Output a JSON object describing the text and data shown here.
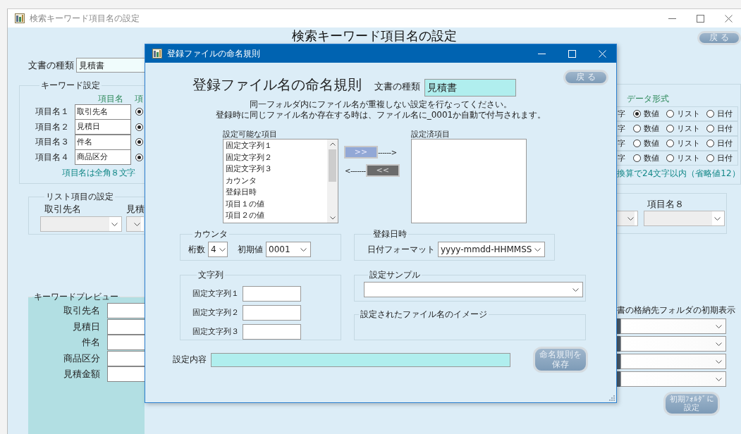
{
  "background_window": {
    "title": "検索キーワード項目名の設定",
    "heading": "検索キーワード項目名の設定",
    "back_button": {
      "label": "戻 る",
      "disabled": true
    },
    "doc_type": {
      "label": "文書の種類",
      "value": "見積書"
    },
    "keyword_settings": {
      "title": "キーワード設定",
      "column_1": "項目名",
      "column_2": "項",
      "note": "項目名は全角８文字",
      "rows": [
        {
          "label": "項目名１",
          "value": "取引先名",
          "option_selected": true
        },
        {
          "label": "項目名２",
          "value": "見積日",
          "option_selected": true
        },
        {
          "label": "項目名３",
          "value": "件名",
          "option_selected": true
        },
        {
          "label": "項目名４",
          "value": "商品区分",
          "option_selected": true
        }
      ]
    },
    "data_format": {
      "title": "データ形式",
      "note": "換算で24文字以内（省略値12）",
      "rows": [
        {
          "fragment": "字",
          "options": [
            {
              "label": "数値",
              "selected": true
            },
            {
              "label": "リスト",
              "selected": false
            },
            {
              "label": "日付",
              "selected": false
            }
          ]
        },
        {
          "fragment": "字",
          "options": [
            {
              "label": "数値",
              "selected": false
            },
            {
              "label": "リスト",
              "selected": false
            },
            {
              "label": "日付",
              "selected": false
            }
          ]
        },
        {
          "fragment": "字",
          "options": [
            {
              "label": "数値",
              "selected": false
            },
            {
              "label": "リスト",
              "selected": false
            },
            {
              "label": "日付",
              "selected": false
            }
          ]
        },
        {
          "fragment": "字",
          "options": [
            {
              "label": "数値",
              "selected": false
            },
            {
              "label": "リスト",
              "selected": false
            },
            {
              "label": "日付",
              "selected": false
            }
          ]
        }
      ]
    },
    "list_settings": {
      "title": "リスト項目の設定",
      "left_labels": [
        "取引先名",
        "見積"
      ],
      "right_labels": [
        "項目名８"
      ]
    },
    "keyword_preview": {
      "title": "キーワードプレビュー",
      "fields": [
        "取引先名",
        "見積日",
        "件名",
        "商品区分",
        "見積金額"
      ]
    },
    "folder_defaults": {
      "title": "書の格納先フォルダの初期表示"
    },
    "set_folder_button": {
      "label": "初期ﾌｫﾙﾀﾞに設定",
      "disabled": true
    }
  },
  "dialog": {
    "title": "登録ファイルの命名規則",
    "back_button": {
      "label": "戻 る",
      "disabled": true
    },
    "heading": "登録ファイル名の命名規則",
    "doc_type": {
      "label": "文書の種類",
      "value": "見積書"
    },
    "instructions": [
      "同一フォルダ内にファイル名が重複しない設定を行なってください。",
      "登録時に同じファイル名か存在する時は、ファイル名に_0001か自動で付与されます。"
    ],
    "available": {
      "title": "設定可能な項目",
      "items": [
        "固定文字列１",
        "固定文字列２",
        "固定文字列３",
        "カウンタ",
        "登録日時",
        "項目１の値",
        "項目２の値"
      ]
    },
    "add_button": ">>",
    "add_arrow": "------>",
    "remove_arrow": "<-------",
    "remove_button": "<<",
    "configured": {
      "title": "設定済項目"
    },
    "counter": {
      "title": "カウンタ",
      "digits_label": "桁数",
      "digits": "4",
      "initial_label": "初期値",
      "initial": "0001"
    },
    "registered_at": {
      "title": "登録日時",
      "format_label": "日付フォーマット",
      "format": "yyyy-mmdd-HHMMSS"
    },
    "strings": {
      "title": "文字列",
      "fields": [
        "固定文字列１",
        "固定文字列２",
        "固定文字列３"
      ]
    },
    "sample": {
      "title": "設定サンプル"
    },
    "image": {
      "title": "設定されたファイル名のイメージ"
    },
    "content": {
      "label": "設定内容"
    },
    "save_button": {
      "label": "命名規則を保存",
      "disabled": true
    }
  }
}
